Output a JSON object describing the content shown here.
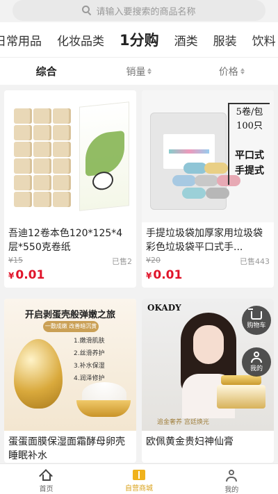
{
  "search": {
    "placeholder": "请输入要搜索的商品名称"
  },
  "categories": [
    "日常用品",
    "化妆品类",
    "1分购",
    "酒类",
    "服装",
    "饮料"
  ],
  "active_category": "1分购",
  "sort": {
    "default_label": "综合",
    "sales_label": "销量",
    "price_label": "价格"
  },
  "products": [
    {
      "name": "吾迪12卷本色120*125*4层*550克卷纸",
      "original_price": "¥15",
      "sold": "已售2",
      "currency": "¥",
      "price": "0.01",
      "image_icon": "toilet-paper-image"
    },
    {
      "name": "手提垃圾袋加厚家用垃圾袋彩色垃圾袋平口式手...",
      "original_price": "¥20",
      "sold": "已售443",
      "currency": "¥",
      "price": "0.01",
      "image_icon": "garbage-bag-image",
      "image_text": {
        "line1": "5卷/包",
        "line2": "100只",
        "line3": "平口式",
        "line4": "手提式"
      }
    },
    {
      "name": "蛋蛋面膜保湿面霜酵母卵壳睡眠补水",
      "image_icon": "egg-mask-image",
      "image_text": {
        "title": "开启剥蛋壳般弹嫩之旅",
        "sub": "一敷成嫩 改善暗沉黄",
        "items": [
          "1.嫩滑肌肤",
          "2.丝滑养护",
          "3.补水保湿",
          "4.润泽修护"
        ]
      }
    },
    {
      "name": "欧佩黄金贵妇神仙膏",
      "image_icon": "gold-cream-image",
      "image_text": {
        "logo": "OKADY",
        "slogan": "追金奢养 宫廷焕光"
      }
    }
  ],
  "float_buttons": {
    "cart_label": "购物车",
    "me_label": "我的"
  },
  "tabbar": {
    "home": "首页",
    "store": "自营商城",
    "me": "我的"
  },
  "colors": {
    "price_red": "#e0142a",
    "accent_gold": "#d9a21b"
  }
}
